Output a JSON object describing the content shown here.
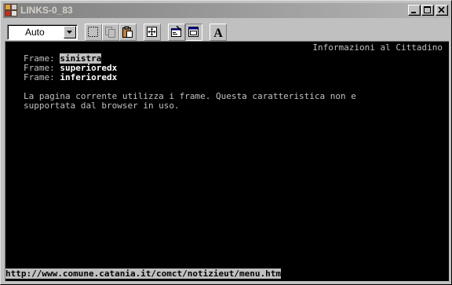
{
  "window": {
    "title": "LINKS-0_83"
  },
  "toolbar": {
    "font_select": {
      "value": "Auto"
    },
    "buttons": [
      {
        "name": "select-all-icon"
      },
      {
        "name": "copy-icon"
      },
      {
        "name": "paste-icon"
      },
      {
        "name": "fullscreen-icon"
      },
      {
        "name": "properties-icon"
      },
      {
        "name": "background-icon"
      },
      {
        "name": "fonts-icon",
        "label": "A"
      }
    ]
  },
  "terminal": {
    "header_right": "Informazioni al Cittadino",
    "frames_label": "Frame:",
    "frames": [
      {
        "name": "sinistra",
        "selected": true
      },
      {
        "name": "superioredx",
        "selected": false
      },
      {
        "name": "inferioredx",
        "selected": false
      }
    ],
    "message_line1": "La pagina corrente utilizza i frame. Questa caratteristica non e",
    "message_line2": "supportata dal browser in uso.",
    "status_url": "http://www.comune.catania.it/comct/notizieut/menu.htm"
  }
}
